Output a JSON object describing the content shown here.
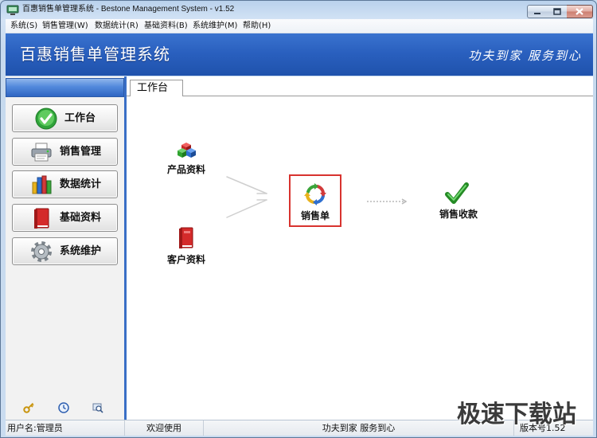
{
  "window": {
    "title": "百惠销售单管理系统 - Bestone Management System - v1.52",
    "app_icon": "app-computer-icon",
    "controls": {
      "minimize": "minimize-icon",
      "maximize": "maximize-icon",
      "close": "close-icon"
    }
  },
  "menu": [
    {
      "label": "系统(S)"
    },
    {
      "label": "销售管理(W)"
    },
    {
      "label": "数据统计(R)"
    },
    {
      "label": "基础资料(B)"
    },
    {
      "label": "系统维护(M)"
    },
    {
      "label": "帮助(H)"
    }
  ],
  "header": {
    "title": "百惠销售单管理系统",
    "slogan": "功夫到家 服务到心"
  },
  "sidebar": {
    "items": [
      {
        "label": "工作台",
        "icon": "check-circle-icon"
      },
      {
        "label": "销售管理",
        "icon": "printer-icon"
      },
      {
        "label": "数据统计",
        "icon": "bar-chart-icon"
      },
      {
        "label": "基础资料",
        "icon": "red-book-icon"
      },
      {
        "label": "系统维护",
        "icon": "gear-icon"
      }
    ],
    "footer_icons": [
      "key-icon",
      "clock-icon",
      "search-icon"
    ]
  },
  "tabs": [
    {
      "label": "工作台",
      "active": true
    }
  ],
  "workflow": {
    "product": {
      "label": "产品资料",
      "icon": "cubes-icon"
    },
    "customer": {
      "label": "客户资料",
      "icon": "red-book-icon"
    },
    "sales_order": {
      "label": "销售单",
      "icon": "recycle-arrows-icon",
      "highlighted": true
    },
    "payment": {
      "label": "销售收款",
      "icon": "green-check-icon"
    }
  },
  "status": {
    "user": "用户名:管理员",
    "welcome": "欢迎使用",
    "slogan": "功夫到家 服务到心",
    "version": "版本号1.52"
  },
  "watermark": {
    "text": "极速下载站"
  },
  "colors": {
    "banner": "#2a60bf",
    "sidebar_separator": "#3a6fc6",
    "highlight_border": "#d8332f",
    "check_green": "#2a9a2a"
  }
}
